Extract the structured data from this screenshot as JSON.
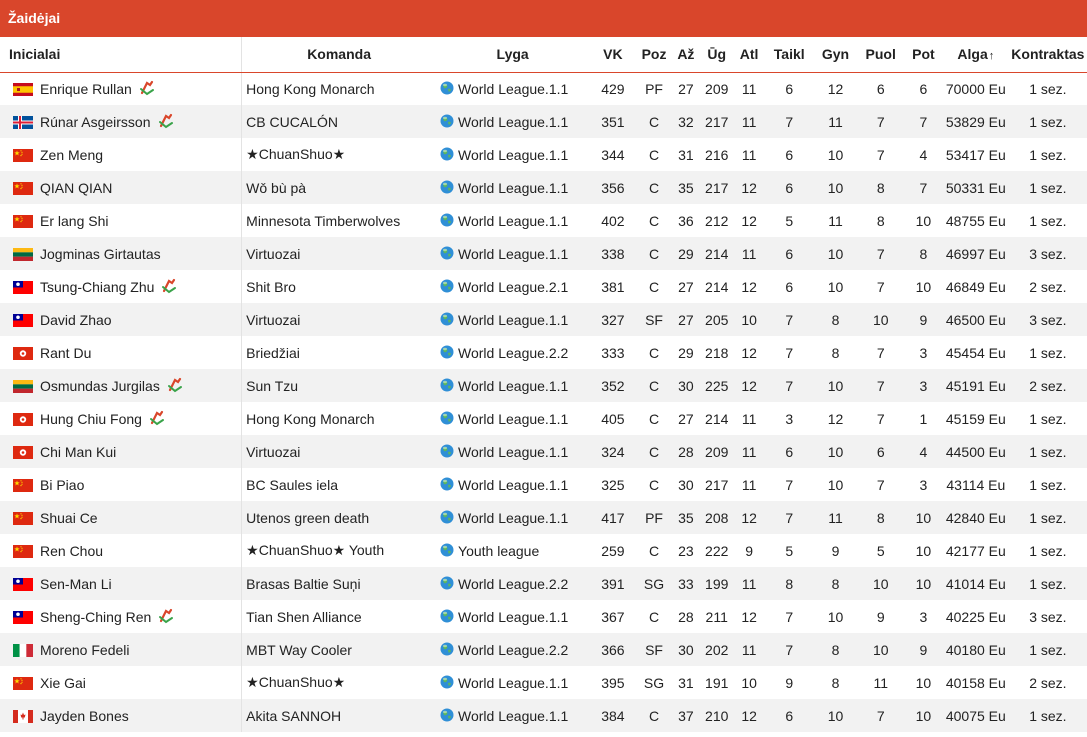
{
  "title": "Žaidėjai",
  "columns": {
    "name": "Inicialai",
    "team": "Komanda",
    "league": "Lyga",
    "vk": "VK",
    "poz": "Poz",
    "az": "Až",
    "ug": "Ūg",
    "atl": "Atl",
    "taikl": "Taikl",
    "gyn": "Gyn",
    "puol": "Puol",
    "pot": "Pot",
    "alga": "Alga",
    "alga_sort_icon": "↑",
    "kontraktas": "Kontraktas"
  },
  "icons": {
    "league": "globe-icon",
    "badge": "transfer-badge-icon"
  },
  "players": [
    {
      "flag": "es",
      "name": "Enrique Rullan",
      "badge": true,
      "team": "Hong Kong Monarch",
      "league": "World League.1.1",
      "vk": "429",
      "poz": "PF",
      "az": "27",
      "ug": "209",
      "atl": "11",
      "taikl": "6",
      "gyn": "12",
      "puol": "6",
      "pot": "6",
      "alga": "70000 Eu",
      "kontraktas": "1 sez."
    },
    {
      "flag": "is",
      "name": "Rúnar Asgeirsson",
      "badge": true,
      "team": "CB CUCALÓN",
      "league": "World League.1.1",
      "vk": "351",
      "poz": "C",
      "az": "32",
      "ug": "217",
      "atl": "11",
      "taikl": "7",
      "gyn": "11",
      "puol": "7",
      "pot": "7",
      "alga": "53829 Eu",
      "kontraktas": "1 sez."
    },
    {
      "flag": "cn",
      "name": "Zen Meng",
      "badge": false,
      "team": "★ChuanShuo★",
      "league": "World League.1.1",
      "vk": "344",
      "poz": "C",
      "az": "31",
      "ug": "216",
      "atl": "11",
      "taikl": "6",
      "gyn": "10",
      "puol": "7",
      "pot": "4",
      "alga": "53417 Eu",
      "kontraktas": "1 sez."
    },
    {
      "flag": "cn",
      "name": "QIAN QIAN",
      "badge": false,
      "team": "Wǒ bù pà",
      "league": "World League.1.1",
      "vk": "356",
      "poz": "C",
      "az": "35",
      "ug": "217",
      "atl": "12",
      "taikl": "6",
      "gyn": "10",
      "puol": "8",
      "pot": "7",
      "alga": "50331 Eu",
      "kontraktas": "1 sez."
    },
    {
      "flag": "cn",
      "name": "Er lang Shi",
      "badge": false,
      "team": "Minnesota Timberwolves",
      "league": "World League.1.1",
      "vk": "402",
      "poz": "C",
      "az": "36",
      "ug": "212",
      "atl": "12",
      "taikl": "5",
      "gyn": "11",
      "puol": "8",
      "pot": "10",
      "alga": "48755 Eu",
      "kontraktas": "1 sez."
    },
    {
      "flag": "lt",
      "name": "Jogminas Girtautas",
      "badge": false,
      "team": "Virtuozai",
      "league": "World League.1.1",
      "vk": "338",
      "poz": "C",
      "az": "29",
      "ug": "214",
      "atl": "11",
      "taikl": "6",
      "gyn": "10",
      "puol": "7",
      "pot": "8",
      "alga": "46997 Eu",
      "kontraktas": "3 sez."
    },
    {
      "flag": "tw",
      "name": "Tsung-Chiang Zhu",
      "badge": true,
      "team": "Shit Bro",
      "league": "World League.2.1",
      "vk": "381",
      "poz": "C",
      "az": "27",
      "ug": "214",
      "atl": "12",
      "taikl": "6",
      "gyn": "10",
      "puol": "7",
      "pot": "10",
      "alga": "46849 Eu",
      "kontraktas": "2 sez."
    },
    {
      "flag": "tw",
      "name": "David Zhao",
      "badge": false,
      "team": "Virtuozai",
      "league": "World League.1.1",
      "vk": "327",
      "poz": "SF",
      "az": "27",
      "ug": "205",
      "atl": "10",
      "taikl": "7",
      "gyn": "8",
      "puol": "10",
      "pot": "9",
      "alga": "46500 Eu",
      "kontraktas": "3 sez."
    },
    {
      "flag": "hk",
      "name": "Rant Du",
      "badge": false,
      "team": "Briedžiai",
      "league": "World League.2.2",
      "vk": "333",
      "poz": "C",
      "az": "29",
      "ug": "218",
      "atl": "12",
      "taikl": "7",
      "gyn": "8",
      "puol": "7",
      "pot": "3",
      "alga": "45454 Eu",
      "kontraktas": "1 sez."
    },
    {
      "flag": "lt",
      "name": "Osmundas Jurgilas",
      "badge": true,
      "team": "Sun Tzu",
      "league": "World League.1.1",
      "vk": "352",
      "poz": "C",
      "az": "30",
      "ug": "225",
      "atl": "12",
      "taikl": "7",
      "gyn": "10",
      "puol": "7",
      "pot": "3",
      "alga": "45191 Eu",
      "kontraktas": "2 sez."
    },
    {
      "flag": "hk",
      "name": "Hung Chiu Fong",
      "badge": true,
      "team": "Hong Kong Monarch",
      "league": "World League.1.1",
      "vk": "405",
      "poz": "C",
      "az": "27",
      "ug": "214",
      "atl": "11",
      "taikl": "3",
      "gyn": "12",
      "puol": "7",
      "pot": "1",
      "alga": "45159 Eu",
      "kontraktas": "1 sez."
    },
    {
      "flag": "hk",
      "name": "Chi Man Kui",
      "badge": false,
      "team": "Virtuozai",
      "league": "World League.1.1",
      "vk": "324",
      "poz": "C",
      "az": "28",
      "ug": "209",
      "atl": "11",
      "taikl": "6",
      "gyn": "10",
      "puol": "6",
      "pot": "4",
      "alga": "44500 Eu",
      "kontraktas": "1 sez."
    },
    {
      "flag": "cn",
      "name": "Bi Piao",
      "badge": false,
      "team": "BC Saules iela",
      "league": "World League.1.1",
      "vk": "325",
      "poz": "C",
      "az": "30",
      "ug": "217",
      "atl": "11",
      "taikl": "7",
      "gyn": "10",
      "puol": "7",
      "pot": "3",
      "alga": "43114 Eu",
      "kontraktas": "1 sez."
    },
    {
      "flag": "cn",
      "name": "Shuai Ce",
      "badge": false,
      "team": "Utenos green death",
      "league": "World League.1.1",
      "vk": "417",
      "poz": "PF",
      "az": "35",
      "ug": "208",
      "atl": "12",
      "taikl": "7",
      "gyn": "11",
      "puol": "8",
      "pot": "10",
      "alga": "42840 Eu",
      "kontraktas": "1 sez."
    },
    {
      "flag": "cn",
      "name": "Ren Chou",
      "badge": false,
      "team": "★ChuanShuo★ Youth",
      "league": "Youth league",
      "vk": "259",
      "poz": "C",
      "az": "23",
      "ug": "222",
      "atl": "9",
      "taikl": "5",
      "gyn": "9",
      "puol": "5",
      "pot": "10",
      "alga": "42177 Eu",
      "kontraktas": "1 sez."
    },
    {
      "flag": "tw",
      "name": "Sen-Man Li",
      "badge": false,
      "team": "Brasas Baltie Suņi",
      "league": "World League.2.2",
      "vk": "391",
      "poz": "SG",
      "az": "33",
      "ug": "199",
      "atl": "11",
      "taikl": "8",
      "gyn": "8",
      "puol": "10",
      "pot": "10",
      "alga": "41014 Eu",
      "kontraktas": "1 sez."
    },
    {
      "flag": "tw",
      "name": "Sheng-Ching Ren",
      "badge": true,
      "team": "Tian Shen Alliance",
      "league": "World League.1.1",
      "vk": "367",
      "poz": "C",
      "az": "28",
      "ug": "211",
      "atl": "12",
      "taikl": "7",
      "gyn": "10",
      "puol": "9",
      "pot": "3",
      "alga": "40225 Eu",
      "kontraktas": "3 sez."
    },
    {
      "flag": "it",
      "name": "Moreno Fedeli",
      "badge": false,
      "team": "MBT Way Cooler",
      "league": "World League.2.2",
      "vk": "366",
      "poz": "SF",
      "az": "30",
      "ug": "202",
      "atl": "11",
      "taikl": "7",
      "gyn": "8",
      "puol": "10",
      "pot": "9",
      "alga": "40180 Eu",
      "kontraktas": "1 sez."
    },
    {
      "flag": "cn",
      "name": "Xie Gai",
      "badge": false,
      "team": "★ChuanShuo★",
      "league": "World League.1.1",
      "vk": "395",
      "poz": "SG",
      "az": "31",
      "ug": "191",
      "atl": "10",
      "taikl": "9",
      "gyn": "8",
      "puol": "11",
      "pot": "10",
      "alga": "40158 Eu",
      "kontraktas": "2 sez."
    },
    {
      "flag": "ca",
      "name": "Jayden Bones",
      "badge": false,
      "team": "Akita SANNOH",
      "league": "World League.1.1",
      "vk": "384",
      "poz": "C",
      "az": "37",
      "ug": "210",
      "atl": "12",
      "taikl": "6",
      "gyn": "10",
      "puol": "7",
      "pot": "10",
      "alga": "40075 Eu",
      "kontraktas": "1 sez."
    }
  ]
}
